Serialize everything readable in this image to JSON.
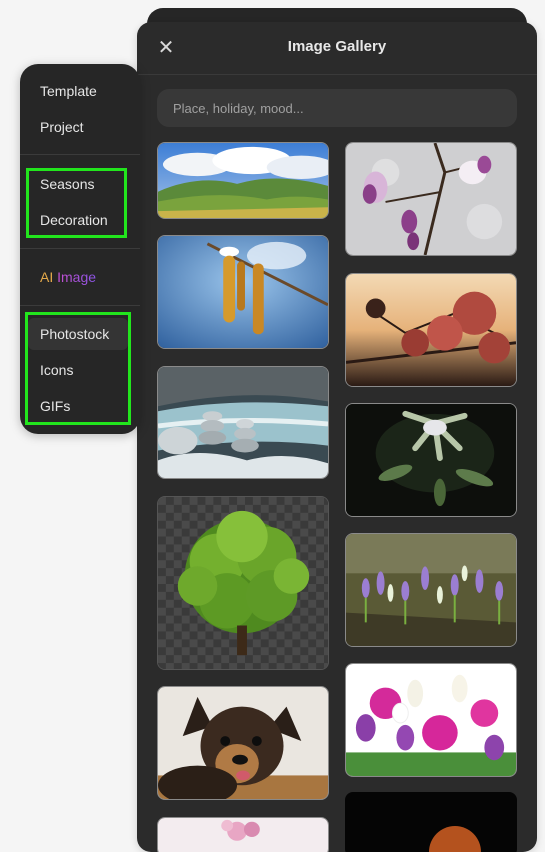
{
  "gallery": {
    "title": "Image Gallery",
    "close_icon": "close-icon",
    "search": {
      "placeholder": "Place, holiday, mood...",
      "value": ""
    },
    "thumbnails": [
      {
        "name": "mountain-landscape"
      },
      {
        "name": "magnolia-blossoms"
      },
      {
        "name": "catkins-snow"
      },
      {
        "name": "red-flowers-sunset"
      },
      {
        "name": "stone-stacks-river"
      },
      {
        "name": "rhododendron-dark"
      },
      {
        "name": "tree-transparent"
      },
      {
        "name": "crocus-field"
      },
      {
        "name": "dog-portrait"
      },
      {
        "name": "rose-tulip-bouquet"
      },
      {
        "name": "pink-flowers-partial"
      },
      {
        "name": "moon-partial"
      }
    ]
  },
  "menu": {
    "items": [
      {
        "label": "Template"
      },
      {
        "label": "Project"
      },
      {
        "label": "Seasons"
      },
      {
        "label": "Decoration"
      },
      {
        "label_a": "AI",
        "label_b": "Image"
      },
      {
        "label": "Photostock"
      },
      {
        "label": "Icons"
      },
      {
        "label": "GIFs"
      }
    ],
    "selected": "Photostock",
    "highlight_color": "#22e51d"
  }
}
